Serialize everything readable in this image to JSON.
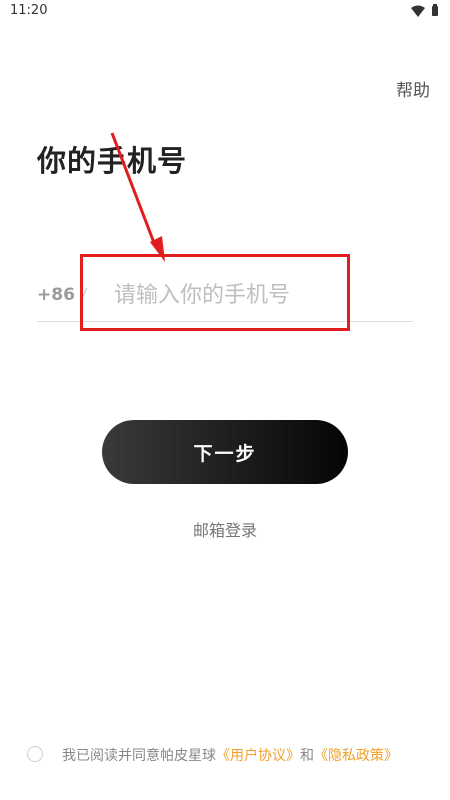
{
  "status_bar": {
    "time": "11:20",
    "icons": [
      "wifi-icon",
      "battery-icon"
    ]
  },
  "header": {
    "help_label": "帮助"
  },
  "main": {
    "title": "你的手机号",
    "country_code": "+86",
    "phone_placeholder": "请输入你的手机号",
    "phone_value": "",
    "next_label": "下一步",
    "email_login_label": "邮箱登录"
  },
  "agreement": {
    "prefix": "我已阅读并同意帕皮星球",
    "user_agreement": "《用户协议》",
    "conjunction": "和",
    "privacy_policy": "《隐私政策》",
    "checked": false
  },
  "colors": {
    "accent_link": "#f0a02a",
    "annotation": "#e11d1d",
    "button_dark": "#050505"
  }
}
